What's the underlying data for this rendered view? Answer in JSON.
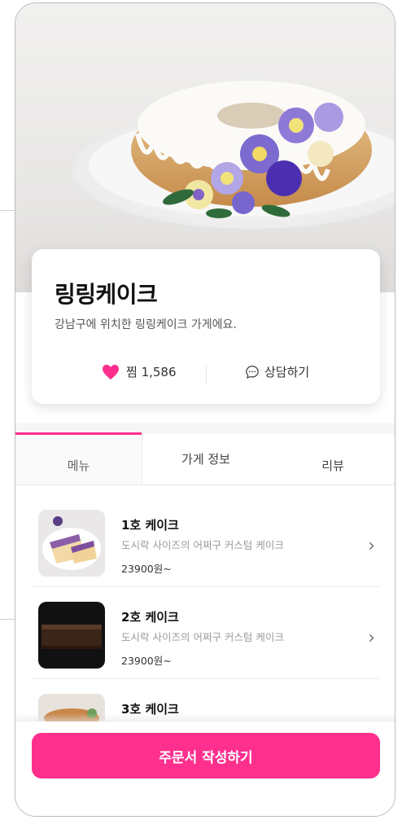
{
  "store": {
    "name": "링링케이크",
    "description": "강남구에 위치한 링링케이크 가게에요.",
    "likes": "찜 1,586",
    "consult_label": "상담하기"
  },
  "tabs": [
    {
      "label": "메뉴"
    },
    {
      "label": "가게 정보"
    },
    {
      "label": "리뷰"
    }
  ],
  "menu": [
    {
      "title": "1호 케이크",
      "description": "도시락 사이즈의 어쩌구 커스텀 케이크",
      "price": "23900원~"
    },
    {
      "title": "2호 케이크",
      "description": "도시락 사이즈의 어쩌구 커스텀 케이크",
      "price": "23900원~"
    },
    {
      "title": "3호 케이크"
    }
  ],
  "order_button": "주문서 작성하기",
  "colors": {
    "accent": "#ff2f8e"
  },
  "icons": [
    "heart-icon",
    "chat-bubble-icon",
    "chevron-right-icon"
  ]
}
